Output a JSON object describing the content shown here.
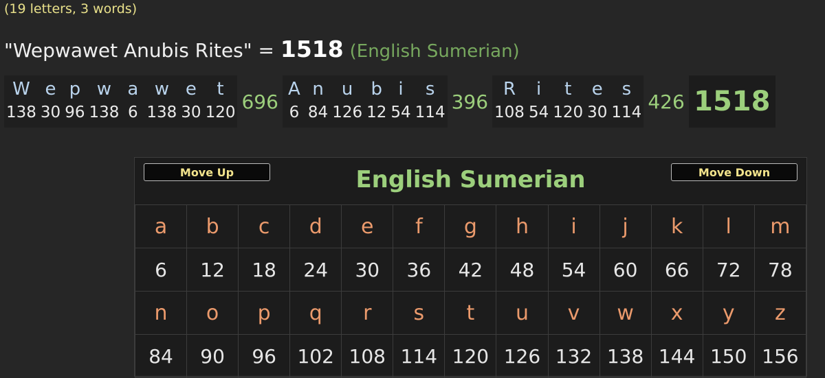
{
  "summary": "(19 letters, 3 words)",
  "phrase": {
    "text": "\"Wepwawet Anubis Rites\"",
    "equals": " = ",
    "total": "1518",
    "cipher": "(English Sumerian)"
  },
  "breakdown": {
    "words": [
      {
        "letters": [
          "W",
          "e",
          "p",
          "w",
          "a",
          "w",
          "e",
          "t"
        ],
        "values": [
          "138",
          "30",
          "96",
          "138",
          "6",
          "138",
          "30",
          "120"
        ],
        "sum": "696"
      },
      {
        "letters": [
          "A",
          "n",
          "u",
          "b",
          "i",
          "s"
        ],
        "values": [
          "6",
          "84",
          "126",
          "12",
          "54",
          "114"
        ],
        "sum": "396"
      },
      {
        "letters": [
          "R",
          "i",
          "t",
          "e",
          "s"
        ],
        "values": [
          "108",
          "54",
          "120",
          "30",
          "114"
        ],
        "sum": "426"
      }
    ],
    "grand_total": "1518"
  },
  "panel": {
    "title": "English Sumerian",
    "move_up": "Move Up",
    "move_down": "Move Down",
    "rows": [
      {
        "letters": [
          "a",
          "b",
          "c",
          "d",
          "e",
          "f",
          "g",
          "h",
          "i",
          "j",
          "k",
          "l",
          "m"
        ],
        "values": [
          "6",
          "12",
          "18",
          "24",
          "30",
          "36",
          "42",
          "48",
          "54",
          "60",
          "66",
          "72",
          "78"
        ]
      },
      {
        "letters": [
          "n",
          "o",
          "p",
          "q",
          "r",
          "s",
          "t",
          "u",
          "v",
          "w",
          "x",
          "y",
          "z"
        ],
        "values": [
          "84",
          "90",
          "96",
          "102",
          "108",
          "114",
          "120",
          "126",
          "132",
          "138",
          "144",
          "150",
          "156"
        ]
      }
    ]
  }
}
